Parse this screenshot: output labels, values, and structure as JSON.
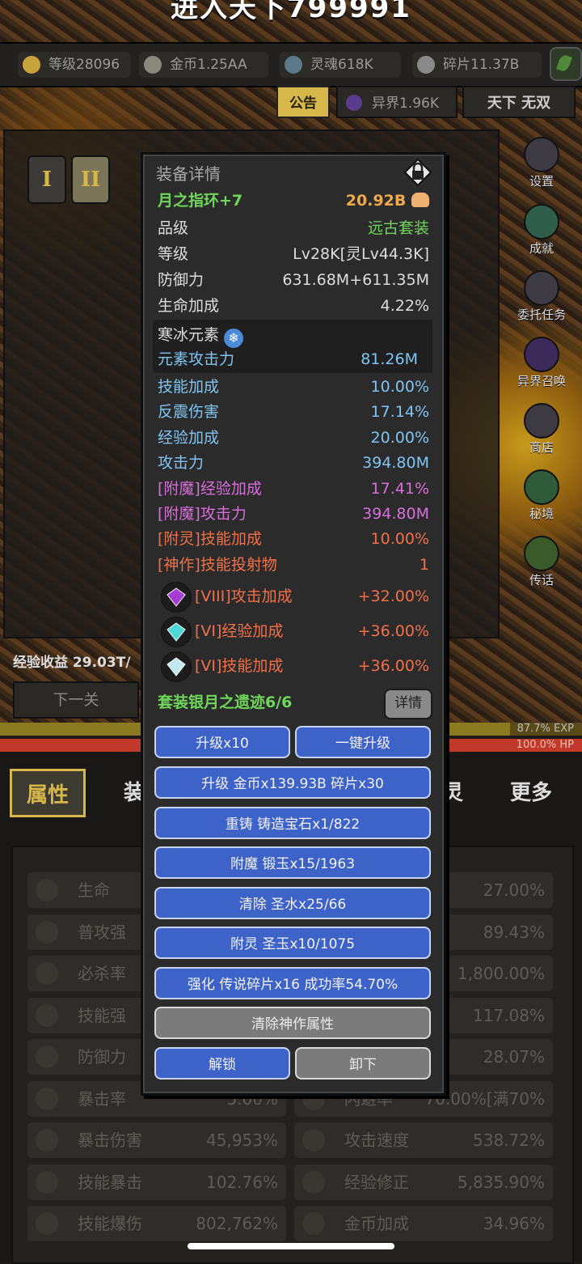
{
  "title": "进入天下799991",
  "resources": [
    {
      "icon": "level-crown-icon",
      "label": "等级28096"
    },
    {
      "icon": "gold-coin-icon",
      "label": "金币1.25AA"
    },
    {
      "icon": "soul-eye-icon",
      "label": "灵魂618K"
    },
    {
      "icon": "shard-icon",
      "label": "碎片11.37B"
    }
  ],
  "notice_label": "公告",
  "otherworld_label": "异界1.96K",
  "tianxia_label": "天下 无双",
  "tabs_roman": [
    "I",
    "II"
  ],
  "side_menu": [
    "设置",
    "成就",
    "委托任务",
    "异界召唤",
    "商店",
    "秘境",
    "传话"
  ],
  "exp_income": "经验收益 29.03T/",
  "next_stage": "下一关",
  "exp_bar": {
    "percent": 87.7,
    "text": "87.7% EXP"
  },
  "hp_bar": {
    "percent": 100.0,
    "text": "100.0%  HP"
  },
  "bottom_tabs": {
    "attr": "属性",
    "equip": "装",
    "spirit": "灵",
    "more": "更多"
  },
  "stats_left": [
    {
      "icon": "plus-icon",
      "name": "生命",
      "value": ""
    },
    {
      "icon": "dagger-icon",
      "name": "普攻强",
      "value": ""
    },
    {
      "icon": "crit-kill-icon",
      "name": "必杀率",
      "value": ""
    },
    {
      "icon": "lightning-icon",
      "name": "技能强",
      "value": ""
    },
    {
      "icon": "shield-icon",
      "name": "防御力",
      "value": ""
    },
    {
      "icon": "crit-icon",
      "name": "暴击率",
      "value": "5.00%"
    },
    {
      "icon": "crit-damage-icon",
      "name": "暴击伤害",
      "value": "45,953%"
    },
    {
      "icon": "flame-icon",
      "name": "技能暴击",
      "value": "102.76%"
    },
    {
      "icon": "flame-icon",
      "name": "技能爆伤",
      "value": "802,762%"
    }
  ],
  "stats_right": [
    {
      "icon": "",
      "name": "",
      "value": "27.00%"
    },
    {
      "icon": "",
      "name": "",
      "value": "89.43%"
    },
    {
      "icon": "",
      "name": "",
      "value": "1,800.00%"
    },
    {
      "icon": "",
      "name": "度",
      "value": "117.08%"
    },
    {
      "icon": "",
      "name": "",
      "value": "28.07%"
    },
    {
      "icon": "horn-icon",
      "name": "闪避率",
      "value": "70.00%[满70%"
    },
    {
      "icon": "swords-icon",
      "name": "攻击速度",
      "value": "538.72%"
    },
    {
      "icon": "crown-icon",
      "name": "经验修正",
      "value": "5,835.90%"
    },
    {
      "icon": "coin-icon",
      "name": "金币加成",
      "value": "34.96%"
    }
  ],
  "modal": {
    "header": "装备详情",
    "item_name": "月之指环+7",
    "power": "20.92B",
    "rows": [
      {
        "label": "品级",
        "value": "远古套装",
        "color": "green"
      },
      {
        "label": "等级",
        "value": "Lv28K[灵Lv44.3K]",
        "color": "white"
      },
      {
        "label": "防御力",
        "value": "631.68M+611.35M",
        "color": "white"
      },
      {
        "label": "生命加成",
        "value": "4.22%",
        "color": "white"
      }
    ],
    "element": {
      "name": "寒冰元素",
      "stat_label": "元素攻击力",
      "stat_value": "81.26M"
    },
    "affixes": [
      {
        "label": "技能加成",
        "value": "10.00%",
        "color": "blue"
      },
      {
        "label": "反震伤害",
        "value": "17.14%",
        "color": "blue"
      },
      {
        "label": "经验加成",
        "value": "20.00%",
        "color": "blue"
      },
      {
        "label": "攻击力",
        "value": "394.80M",
        "color": "blue"
      },
      {
        "label": "[附魔]经验加成",
        "value": "17.41%",
        "color": "purple"
      },
      {
        "label": "[附魔]攻击力",
        "value": "394.80M",
        "color": "purple"
      },
      {
        "label": "[附灵]技能加成",
        "value": "10.00%",
        "color": "red"
      },
      {
        "label": "[神作]技能投射物",
        "value": "1",
        "color": "red"
      }
    ],
    "gems": [
      {
        "gem": "purple-gem-icon",
        "label": "[VIII]攻击加成",
        "value": "+32.00%",
        "color": "#a63bd6"
      },
      {
        "gem": "cyan-gem-icon",
        "label": "[VI]经验加成",
        "value": "+36.00%",
        "color": "#4fd6d6"
      },
      {
        "gem": "white-gem-icon",
        "label": "[VI]技能加成",
        "value": "+36.00%",
        "color": "#bfe8f0"
      }
    ],
    "set_label": "套装银月之遗迹6/6",
    "detail_btn": "详情",
    "buttons": {
      "upgrade10": "升级x10",
      "upgrade_all": "一键升级",
      "upgrade_cost": "升级 金币x139.93B 碎片x30",
      "reforge": "重铸 铸造宝石x1/822",
      "enchant": "附魔 锻玉x15/1963",
      "clear": "清除 圣水x25/66",
      "spirit": "附灵 圣玉x10/1075",
      "strengthen": "强化 传说碎片x16 成功率54.70%",
      "clear_divine": "清除神作属性",
      "unlock": "解锁",
      "unequip": "卸下"
    }
  }
}
